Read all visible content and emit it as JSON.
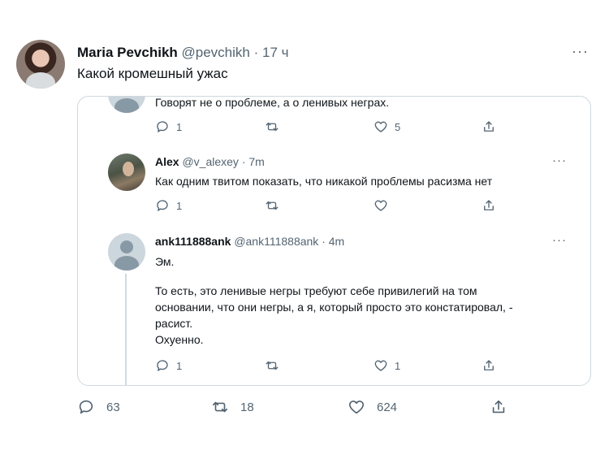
{
  "tweet": {
    "author_name": "Maria Pevchikh",
    "handle": "@pevchikh",
    "separator": "·",
    "time": "17 ч",
    "more": "···",
    "text": "Какой кромешный ужас",
    "counts": {
      "replies": "63",
      "retweets": "18",
      "likes": "624"
    }
  },
  "embed": {
    "top_tweet": {
      "text": "Говорят не о проблеме, а о ленивых неграх.",
      "counts": {
        "replies": "1",
        "retweets": "",
        "likes": "5"
      }
    },
    "tweets": [
      {
        "author_name": "Alex",
        "handle": "@v_alexey",
        "separator": "·",
        "time": "7m",
        "more": "···",
        "lines": [
          "Как одним твитом показать, что никакой проблемы расизма нет"
        ],
        "counts": {
          "replies": "1",
          "retweets": "",
          "likes": ""
        }
      },
      {
        "author_name": "ank111888ank",
        "handle": "@ank111888ank",
        "separator": "·",
        "time": "4m",
        "more": "···",
        "lines": [
          "Эм.",
          "",
          "То есть, это ленивые негры требуют себе привилегий на том",
          "основании, что они негры, а я, который просто это констатировал, -",
          "расист.",
          "Охуенно."
        ],
        "counts": {
          "replies": "1",
          "retweets": "",
          "likes": "1"
        }
      }
    ]
  },
  "icons": {
    "reply": "reply-icon",
    "retweet": "retweet-icon",
    "like": "like-icon",
    "share": "share-icon"
  },
  "colors": {
    "text": "#0f1419",
    "secondary": "#536471",
    "border": "#cfd9de"
  }
}
